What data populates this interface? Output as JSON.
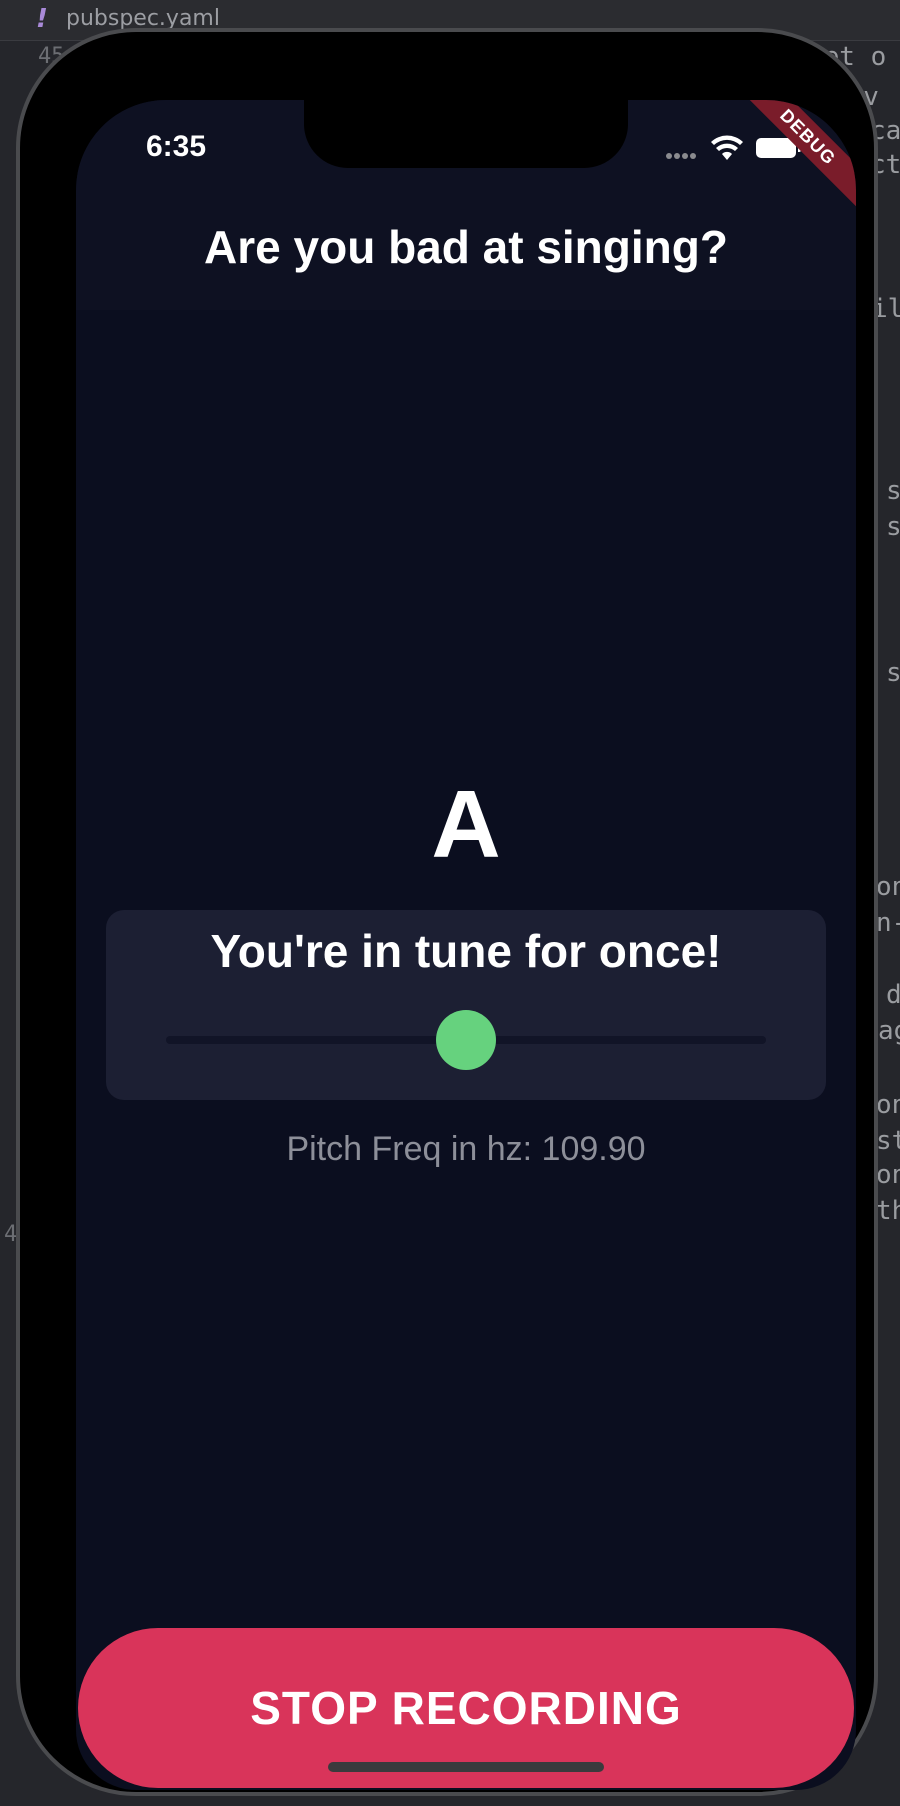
{
  "editor": {
    "tab_filename": "pubspec.yaml",
    "tab_marker": "!",
    "line_number": "45",
    "line_number_2": "4",
    "code_fragments": [
      "set o",
      "rov",
      "ca",
      "ct",
      "il",
      "s",
      "s",
      "s",
      "on",
      "n-",
      "d",
      "ag",
      "on",
      "st",
      "on",
      "th"
    ]
  },
  "status_bar": {
    "time": "6:35",
    "debug_banner": "DEBUG"
  },
  "app": {
    "title": "Are you bad at singing?",
    "note": "A",
    "tune_message": "You're in tune for once!",
    "tuning_position": 0.5,
    "pitch_text": "Pitch Freq in hz: 109.90",
    "stop_button_label": "STOP RECORDING"
  },
  "colors": {
    "background": "#0b0e1f",
    "card": "#1c1f33",
    "accent_green": "#66d27e",
    "stop_button": "#d9345a"
  }
}
